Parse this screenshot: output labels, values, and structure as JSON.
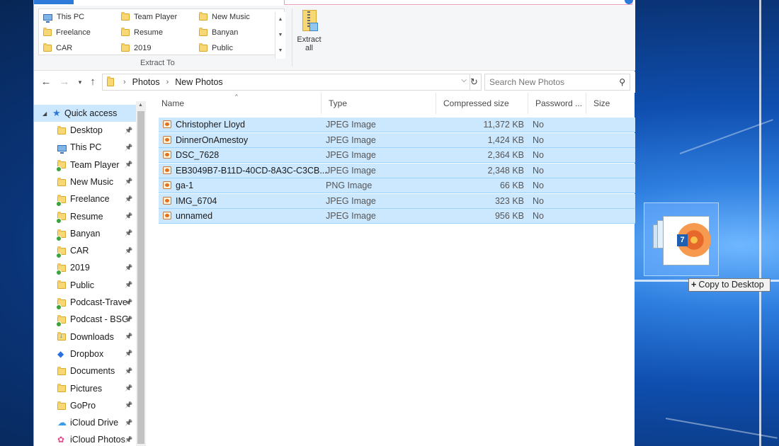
{
  "ribbon": {
    "gallery": [
      [
        "This PC",
        "Team Player",
        "New Music"
      ],
      [
        "Freelance",
        "Resume",
        "Banyan"
      ],
      [
        "CAR",
        "2019",
        "Public"
      ]
    ],
    "group_label": "Extract To",
    "extract_all_line1": "Extract",
    "extract_all_line2": "all"
  },
  "address": {
    "crumbs": [
      "Photos",
      "New Photos"
    ],
    "search_placeholder": "Search New Photos"
  },
  "sidebar": {
    "quick_access": "Quick access",
    "items": [
      {
        "label": "Desktop",
        "icon": "desktop-folder-icon"
      },
      {
        "label": "This PC",
        "icon": "this-pc-icon"
      },
      {
        "label": "Team Player",
        "icon": "folder-icon"
      },
      {
        "label": "New Music",
        "icon": "folder-icon"
      },
      {
        "label": "Freelance",
        "icon": "folder-icon"
      },
      {
        "label": "Resume",
        "icon": "folder-icon"
      },
      {
        "label": "Banyan",
        "icon": "folder-icon"
      },
      {
        "label": "CAR",
        "icon": "folder-icon"
      },
      {
        "label": "2019",
        "icon": "folder-icon"
      },
      {
        "label": "Public",
        "icon": "folder-icon"
      },
      {
        "label": "Podcast-Trave",
        "icon": "folder-icon"
      },
      {
        "label": "Podcast - BSG",
        "icon": "folder-icon"
      },
      {
        "label": "Downloads",
        "icon": "downloads-icon"
      },
      {
        "label": "Dropbox",
        "icon": "dropbox-icon"
      },
      {
        "label": "Documents",
        "icon": "documents-icon"
      },
      {
        "label": "Pictures",
        "icon": "pictures-icon"
      },
      {
        "label": "GoPro",
        "icon": "folder-icon"
      },
      {
        "label": "iCloud Drive",
        "icon": "icloud-icon"
      },
      {
        "label": "iCloud Photos",
        "icon": "icloud-photos-icon"
      }
    ]
  },
  "columns": {
    "name": "Name",
    "type": "Type",
    "compressed_size": "Compressed size",
    "password": "Password ...",
    "size": "Size"
  },
  "files": [
    {
      "name": "Christopher Lloyd",
      "type": "JPEG Image",
      "compressed": "11,372 KB",
      "password": "No"
    },
    {
      "name": "DinnerOnAmestoy",
      "type": "JPEG Image",
      "compressed": "1,424 KB",
      "password": "No"
    },
    {
      "name": "DSC_7628",
      "type": "JPEG Image",
      "compressed": "2,364 KB",
      "password": "No"
    },
    {
      "name": "EB3049B7-B11D-40CD-8A3C-C3CB...",
      "type": "JPEG Image",
      "compressed": "2,348 KB",
      "password": "No"
    },
    {
      "name": "ga-1",
      "type": "PNG Image",
      "compressed": "66 KB",
      "password": "No"
    },
    {
      "name": "IMG_6704",
      "type": "JPEG Image",
      "compressed": "323 KB",
      "password": "No"
    },
    {
      "name": "unnamed",
      "type": "JPEG Image",
      "compressed": "956 KB",
      "password": "No"
    }
  ],
  "drag": {
    "count": "7",
    "tooltip": "Copy to Desktop"
  }
}
